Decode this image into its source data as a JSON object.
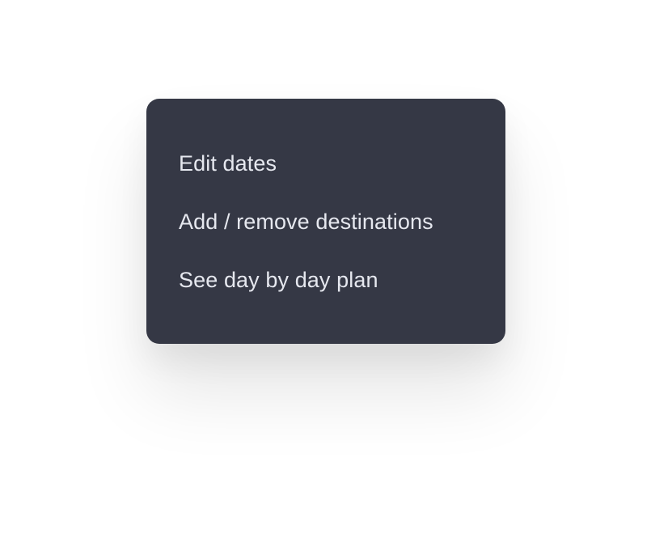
{
  "menu": {
    "background": "#353845",
    "text_color": "#e6e8ef",
    "items": [
      {
        "label": "Edit dates"
      },
      {
        "label": "Add / remove destinations"
      },
      {
        "label": "See day by day plan"
      }
    ]
  }
}
